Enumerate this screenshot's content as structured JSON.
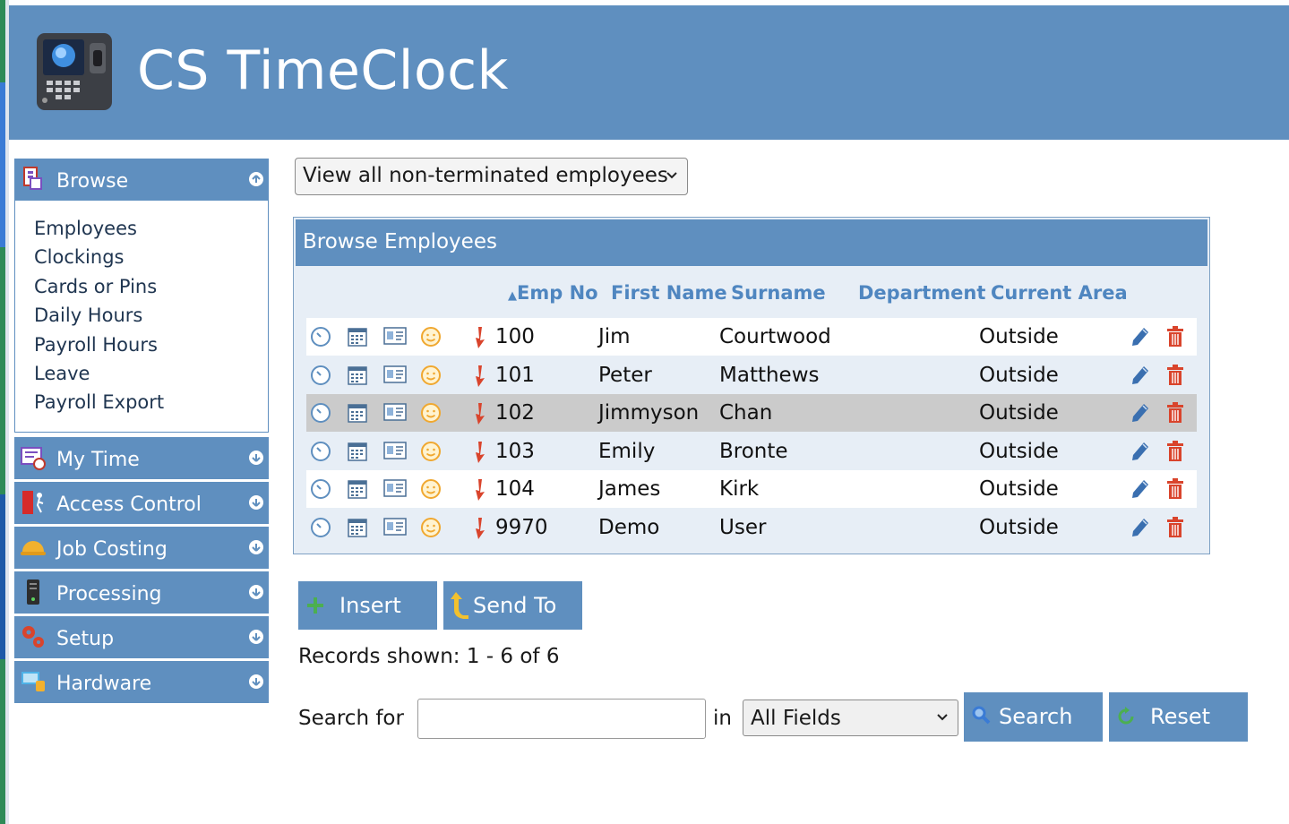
{
  "app": {
    "title": "CS TimeClock"
  },
  "sidebar": {
    "sections": [
      {
        "label": "Browse",
        "expanded": true
      },
      {
        "label": "My Time"
      },
      {
        "label": "Access Control"
      },
      {
        "label": "Job Costing"
      },
      {
        "label": "Processing"
      },
      {
        "label": "Setup"
      },
      {
        "label": "Hardware"
      }
    ],
    "browse_links": [
      "Employees",
      "Clockings",
      "Cards or Pins",
      "Daily Hours",
      "Payroll Hours",
      "Leave",
      "Payroll Export"
    ]
  },
  "filter": {
    "selected": "View all non-terminated employees"
  },
  "grid": {
    "title": "Browse Employees",
    "sort_indicator": "▲",
    "columns": [
      "Emp No",
      "First Name",
      "Surname",
      "Department",
      "Current Area"
    ],
    "rows": [
      {
        "emp_no": "100",
        "first": "Jim",
        "surname": "Courtwood",
        "dept": "",
        "area": "Outside"
      },
      {
        "emp_no": "101",
        "first": "Peter",
        "surname": "Matthews",
        "dept": "",
        "area": "Outside"
      },
      {
        "emp_no": "102",
        "first": "Jimmyson",
        "surname": "Chan",
        "dept": "",
        "area": "Outside"
      },
      {
        "emp_no": "103",
        "first": "Emily",
        "surname": "Bronte",
        "dept": "",
        "area": "Outside"
      },
      {
        "emp_no": "104",
        "first": "James",
        "surname": "Kirk",
        "dept": "",
        "area": "Outside"
      },
      {
        "emp_no": "9970",
        "first": "Demo",
        "surname": "User",
        "dept": "",
        "area": "Outside"
      }
    ],
    "selected_row": 2
  },
  "actions": {
    "insert": "Insert",
    "send_to": "Send To"
  },
  "records": "Records shown: 1 - 6 of 6",
  "search": {
    "label": "Search for",
    "value": "",
    "in_label": "in",
    "field": "All Fields",
    "search_btn": "Search",
    "reset_btn": "Reset"
  },
  "colors": {
    "header": "#5f8fbf",
    "column_header_text": "#4f86c0",
    "selected_row": "#cbcbcb",
    "delete_icon": "#d9442c",
    "edit_icon": "#3a6fb0"
  }
}
